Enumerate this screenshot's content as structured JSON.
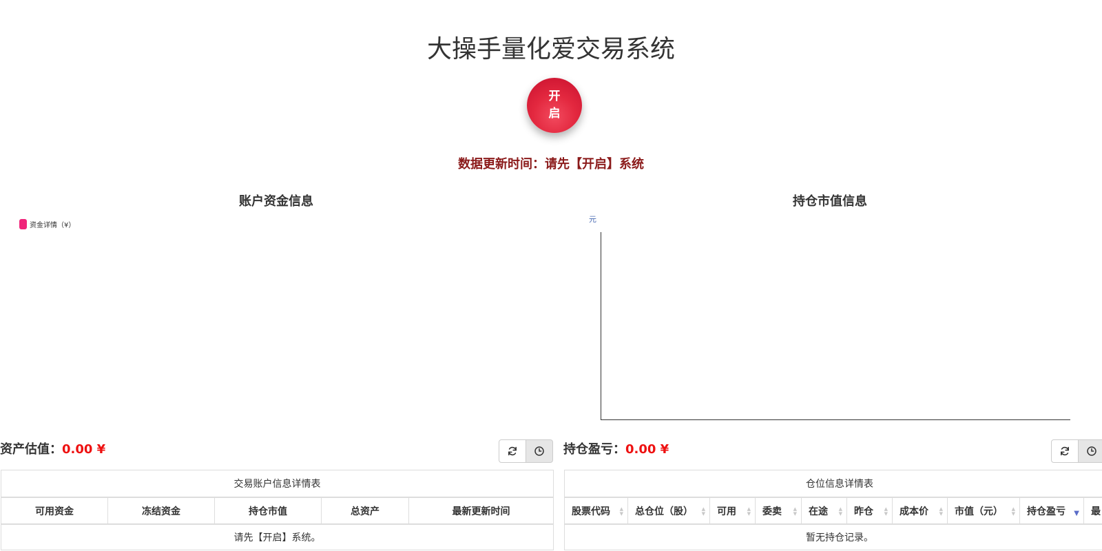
{
  "app": {
    "title": "大操手量化爱交易系统",
    "power_button": {
      "line1": "开",
      "line2": "启",
      "color": "#e3283f"
    },
    "update_time": "数据更新时间：请先【开启】系统"
  },
  "left_panel": {
    "title": "账户资金信息",
    "legend_label": "资金详情（¥）",
    "legend_color": "#f0247a",
    "asset_label": "资产估值：",
    "asset_value": "0.00 ¥",
    "buttons": [
      {
        "icon": "refresh-icon"
      },
      {
        "icon": "clock-icon"
      }
    ],
    "table": {
      "caption": "交易账户信息详情表",
      "columns": [
        "可用资金",
        "冻结资金",
        "持仓市值",
        "总资产",
        "最新更新时间"
      ],
      "empty_text": "请先【开启】系统。"
    }
  },
  "right_panel": {
    "title": "持仓市值信息",
    "chart_unit": "元",
    "pnl_label": "持仓盈亏：",
    "pnl_value": "0.00 ¥",
    "buttons": [
      {
        "icon": "refresh-icon"
      },
      {
        "icon": "clock-icon"
      }
    ],
    "table": {
      "caption": "仓位信息详情表",
      "columns": [
        "股票代码",
        "总仓位（股）",
        "可用",
        "委卖",
        "在途",
        "昨仓",
        "成本价",
        "市值（元）",
        "持仓盈亏",
        "最"
      ],
      "empty_text": "暂无持仓记录。"
    }
  }
}
